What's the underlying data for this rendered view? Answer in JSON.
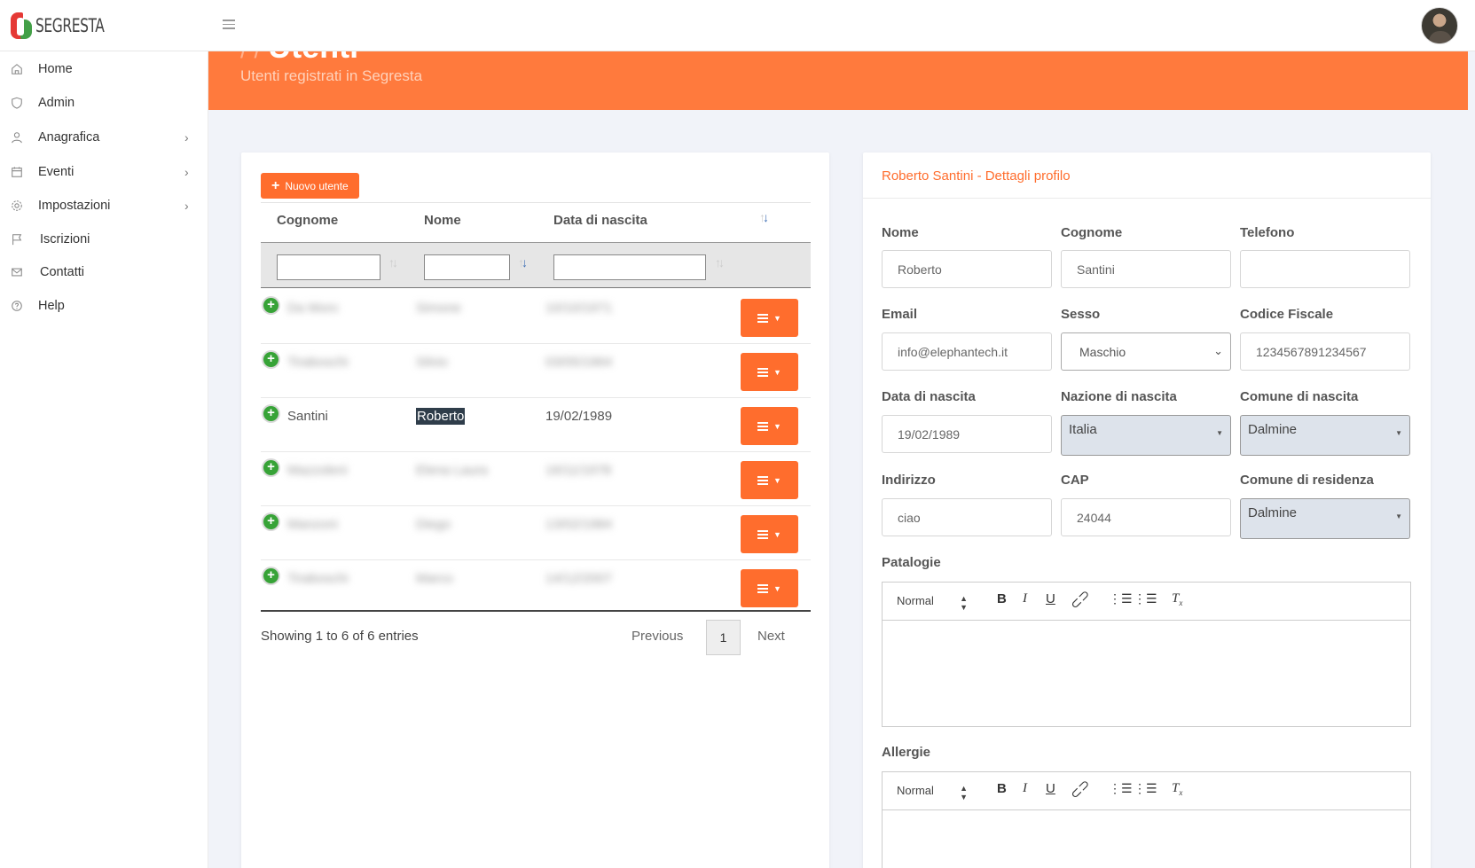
{
  "app": {
    "logo_text": "SEGRESTA"
  },
  "header": {
    "title": "Utenti",
    "subtitle": "Utenti registrati in Segresta"
  },
  "sidebar": {
    "items": [
      {
        "label": "Home",
        "icon": "home-icon",
        "chevron": false
      },
      {
        "label": "Admin",
        "icon": "shield-icon",
        "chevron": false
      },
      {
        "label": "Anagrafica",
        "icon": "user-icon",
        "chevron": true
      },
      {
        "label": "Eventi",
        "icon": "calendar-icon",
        "chevron": true
      },
      {
        "label": "Impostazioni",
        "icon": "gear-icon",
        "chevron": true
      },
      {
        "label": "Iscrizioni",
        "icon": "flag-icon",
        "chevron": false
      },
      {
        "label": "Contatti",
        "icon": "mail-icon",
        "chevron": false
      },
      {
        "label": "Help",
        "icon": "help-icon",
        "chevron": false
      }
    ]
  },
  "users_table": {
    "new_button": "Nuovo utente",
    "columns": [
      "Cognome",
      "Nome",
      "Data di nascita"
    ],
    "rows": [
      {
        "cognome": "Da Moro",
        "nome": "Simone",
        "data": "10/10/1971",
        "blurred": true
      },
      {
        "cognome": "Tiraboschi",
        "nome": "Silvio",
        "data": "03/05/1964",
        "blurred": true
      },
      {
        "cognome": "Santini",
        "nome": "Roberto",
        "data": "19/02/1989",
        "blurred": false
      },
      {
        "cognome": "Mazzoleni",
        "nome": "Elena Laura",
        "data": "16/11/1978",
        "blurred": true
      },
      {
        "cognome": "Manzoni",
        "nome": "Diego",
        "data": "13/02/1984",
        "blurred": true
      },
      {
        "cognome": "Tiraboschi",
        "nome": "Marco",
        "data": "14/12/2007",
        "blurred": true
      }
    ],
    "info": "Showing 1 to 6 of 6 entries",
    "pagination": {
      "previous": "Previous",
      "page": "1",
      "next": "Next"
    }
  },
  "profile": {
    "title": "Roberto Santini - Dettagli profilo",
    "fields": {
      "nome": {
        "label": "Nome",
        "value": "Roberto"
      },
      "cognome": {
        "label": "Cognome",
        "value": "Santini"
      },
      "telefono": {
        "label": "Telefono",
        "value": ""
      },
      "email": {
        "label": "Email",
        "value": "info@elephantech.it"
      },
      "sesso": {
        "label": "Sesso",
        "value": "Maschio"
      },
      "codice_fiscale": {
        "label": "Codice Fiscale",
        "value": "1234567891234567"
      },
      "data_nascita": {
        "label": "Data di nascita",
        "value": "19/02/1989"
      },
      "nazione_nascita": {
        "label": "Nazione di nascita",
        "value": "Italia"
      },
      "comune_nascita": {
        "label": "Comune di nascita",
        "value": "Dalmine"
      },
      "indirizzo": {
        "label": "Indirizzo",
        "value": "ciao"
      },
      "cap": {
        "label": "CAP",
        "value": "24044"
      },
      "comune_residenza": {
        "label": "Comune di residenza",
        "value": "Dalmine"
      }
    },
    "patalogie_label": "Patalogie",
    "allergie_label": "Allergie",
    "editor_format": "Normal"
  },
  "colors": {
    "accent": "#ff6d2d",
    "header": "#ff7a3d",
    "add_row": "#37a337"
  }
}
